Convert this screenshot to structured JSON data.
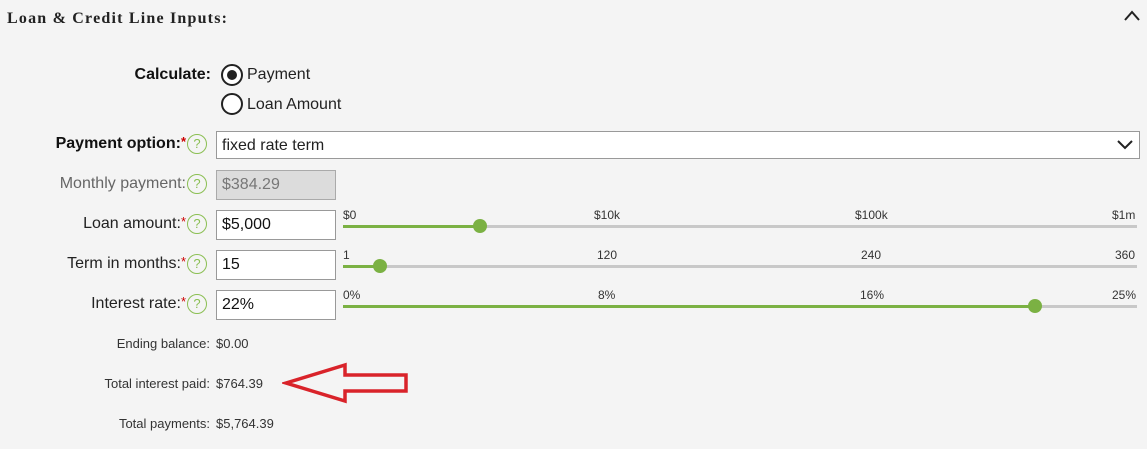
{
  "header": {
    "title": "Loan & Credit Line Inputs:"
  },
  "calculate": {
    "label": "Calculate:",
    "options": [
      {
        "label": "Payment",
        "selected": true
      },
      {
        "label": "Loan Amount",
        "selected": false
      }
    ]
  },
  "payment_option": {
    "label": "Payment option:",
    "required_mark": "*",
    "value": "fixed rate term"
  },
  "monthly_payment": {
    "label": "Monthly payment:",
    "value": "$384.29"
  },
  "loan_amount": {
    "label": "Loan amount:",
    "required_mark": "*",
    "value": "$5,000",
    "slider": {
      "ticks": [
        "$0",
        "$10k",
        "$100k",
        "$1m"
      ],
      "position_fraction": 0.173
    }
  },
  "term": {
    "label": "Term in months:",
    "required_mark": "*",
    "value": "15",
    "slider": {
      "ticks": [
        "1",
        "120",
        "240",
        "360"
      ],
      "position_fraction": 0.046
    }
  },
  "interest_rate": {
    "label": "Interest rate:",
    "required_mark": "*",
    "value": "22%",
    "slider": {
      "ticks": [
        "0%",
        "8%",
        "16%",
        "25%"
      ],
      "position_fraction": 0.872
    }
  },
  "results": {
    "ending_balance": {
      "label": "Ending balance:",
      "value": "$0.00"
    },
    "total_interest": {
      "label": "Total interest paid:",
      "value": "$764.39"
    },
    "total_payments": {
      "label": "Total payments:",
      "value": "$5,764.39"
    }
  },
  "help_symbol": "?",
  "colors": {
    "accent": "#7bb143",
    "required": "#cc0000",
    "annotation_arrow": "#d9232a"
  }
}
